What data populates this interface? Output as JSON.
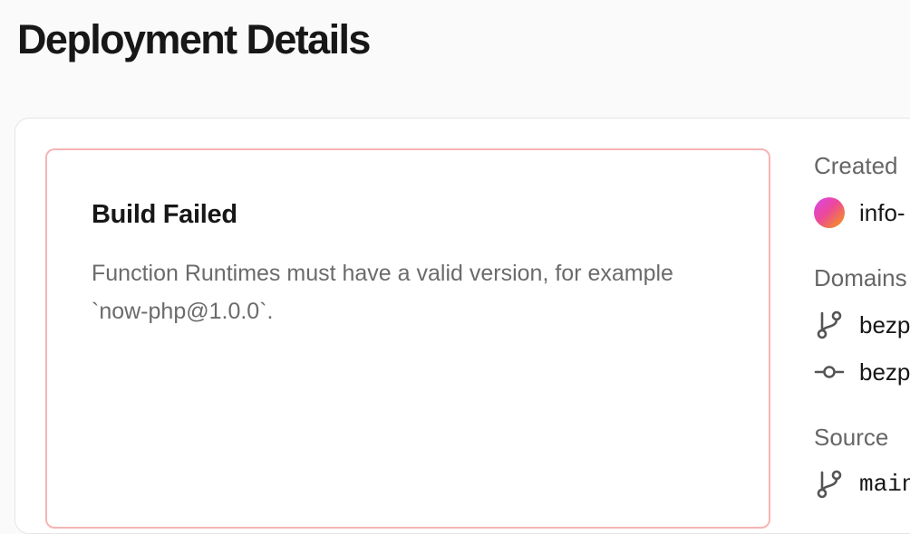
{
  "page": {
    "title": "Deployment Details"
  },
  "error": {
    "title": "Build Failed",
    "message": "Function Runtimes must have a valid version, for example `now-php@1.0.0`."
  },
  "sidebar": {
    "created_label": "Created",
    "created_by": "info-",
    "domains_label": "Domains",
    "domains": [
      {
        "icon": "git-branch-icon",
        "text": "bezp"
      },
      {
        "icon": "git-commit-icon",
        "text": "bezp"
      }
    ],
    "source_label": "Source",
    "source": {
      "icon": "git-branch-icon",
      "text": "main"
    }
  },
  "colors": {
    "error_border": "#f8b4b4",
    "avatar_gradient": [
      "#d946ef",
      "#ec4899",
      "#f59e0b"
    ]
  }
}
